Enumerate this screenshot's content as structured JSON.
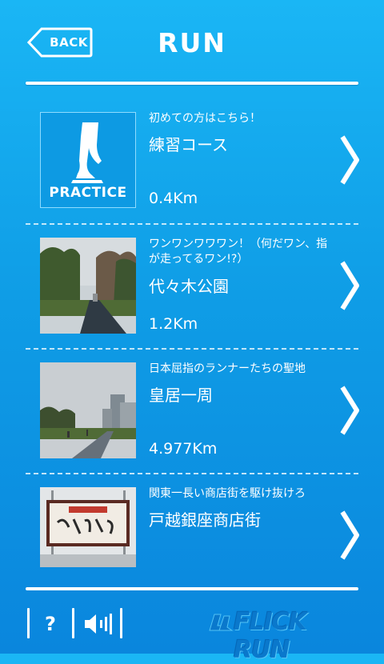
{
  "header": {
    "title": "RUN",
    "back_label": "BACK"
  },
  "courses": [
    {
      "subtitle": "初めての方はこちら！",
      "name": "練習コース",
      "distance": "0.4Km",
      "thumb_label": "PRACTICE",
      "thumb_icon": "finger-runner-icon"
    },
    {
      "subtitle": "ワンワンワワワン！（何だワン、指が走ってるワン!?）",
      "name": "代々木公園",
      "distance": "1.2Km",
      "thumb_icon": "park-photo"
    },
    {
      "subtitle": "日本屈指のランナーたちの聖地",
      "name": "皇居一周",
      "distance": "4.977Km",
      "thumb_icon": "palace-photo"
    },
    {
      "subtitle": "関東一長い商店街を駆け抜けろ",
      "name": "戸越銀座商店街",
      "distance": "",
      "thumb_icon": "shopping-street-photo"
    }
  ],
  "footer": {
    "help_label": "?",
    "sound_icon": "speaker-icon",
    "logo_text": "FLICK RUN"
  },
  "colors": {
    "background_top": "#1ab6f5",
    "background_bottom": "#0a86dd",
    "text": "#ffffff"
  }
}
